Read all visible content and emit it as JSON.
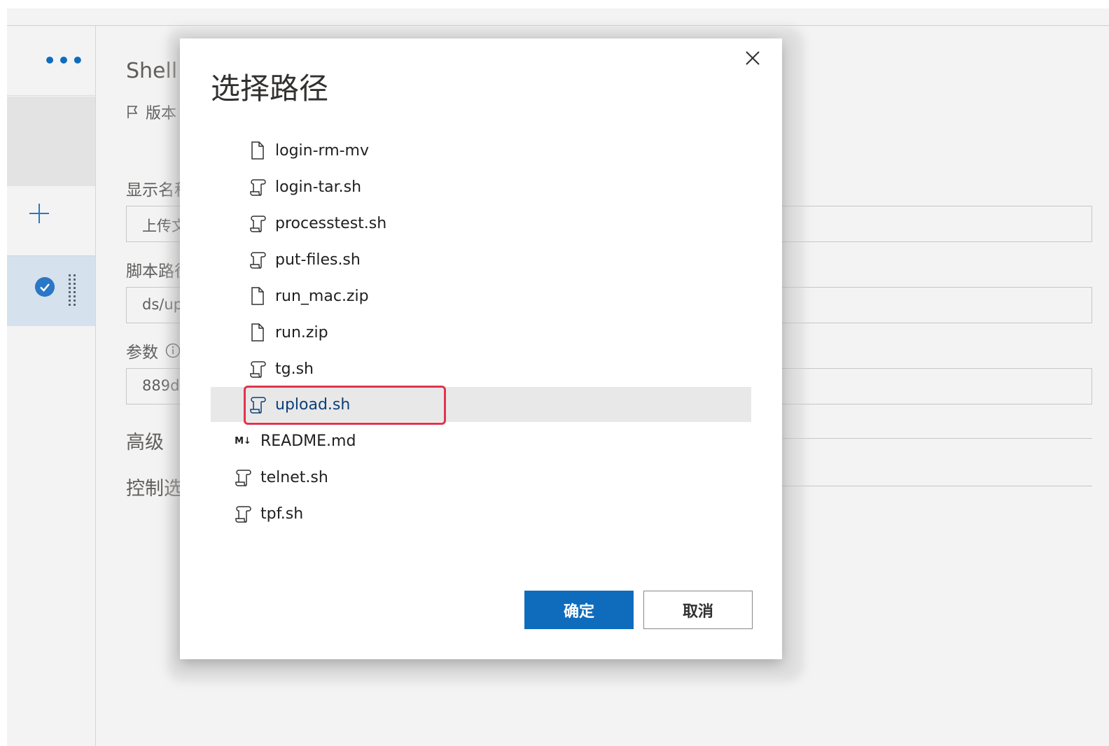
{
  "background": {
    "left_more_label": "•••",
    "heading": "Shell 脚本",
    "version_label": "版本",
    "display_name_label": "显示名称",
    "display_name_value": "上传文件",
    "script_path_label": "脚本路径",
    "script_path_value": "ds/upload.sh",
    "params_label": "参数",
    "params_value": "889d",
    "advanced_label": "高级",
    "control_label": "控制选项"
  },
  "dialog": {
    "title": "选择路径",
    "close_icon": "close-icon",
    "items": [
      {
        "label": "login-rm-mv",
        "icon": "file-icon"
      },
      {
        "label": "login-tar.sh",
        "icon": "script-icon"
      },
      {
        "label": "processtest.sh",
        "icon": "script-icon"
      },
      {
        "label": "put-files.sh",
        "icon": "script-icon"
      },
      {
        "label": "run_mac.zip",
        "icon": "file-icon"
      },
      {
        "label": "run.zip",
        "icon": "file-icon"
      },
      {
        "label": "tg.sh",
        "icon": "script-icon"
      },
      {
        "label": "upload.sh",
        "icon": "script-icon",
        "selected": true
      },
      {
        "label": "README.md",
        "icon": "markdown-icon",
        "badge": "M↓"
      },
      {
        "label": "telnet.sh",
        "icon": "script-icon"
      },
      {
        "label": "tpf.sh",
        "icon": "script-icon"
      }
    ],
    "ok_label": "确定",
    "cancel_label": "取消"
  },
  "colors": {
    "primary": "#0f6cbd",
    "highlight": "#e0344d",
    "selected_row": "#e8e8e8"
  }
}
